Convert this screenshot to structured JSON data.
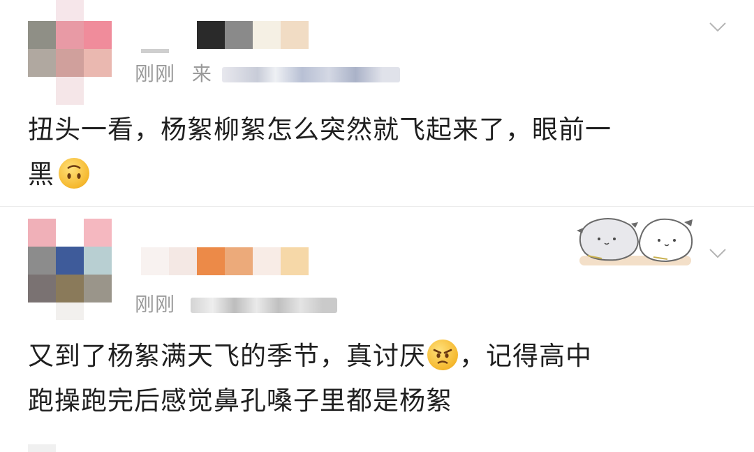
{
  "comments": [
    {
      "time": "刚刚",
      "source_prefix": "来",
      "text_line1": "扭头一看，杨絮柳絮怎么突然就飞起来了，眼前一",
      "text_line2": "黑",
      "emoji": "upside-down-face",
      "avatar_colors": [
        "#8f8f86",
        "#e89aa5",
        "#f08c9b",
        "#b0a8a0",
        "#d0a09c",
        "#eab8b0",
        "#ffffff",
        "#f5e6e8",
        "#ffffff"
      ],
      "name_colors": [
        "#2a2a2a",
        "#8a8a8a",
        "#f5f0e4",
        "#f1dcc4"
      ]
    },
    {
      "time": "刚刚",
      "text_line1": "又到了杨絮满天飞的季节，真讨厌",
      "text_line1b": "，记得高中",
      "text_line2": "跑操跑完后感觉鼻孔嗓子里都是杨絮",
      "emoji": "angry-face",
      "avatar_colors": [
        "#f0b0b8",
        "#ffffff",
        "#f5b8c0",
        "#8c8c8c",
        "#3e5b9a",
        "#b8cfd2",
        "#7a7272",
        "#8a7a5a",
        "#9a958a"
      ],
      "name_colors": [
        "#f8f2f0",
        "#f4e8e4",
        "#ec8a48",
        "#ecaa7a",
        "#f8ece6",
        "#f6d8a8"
      ]
    }
  ]
}
